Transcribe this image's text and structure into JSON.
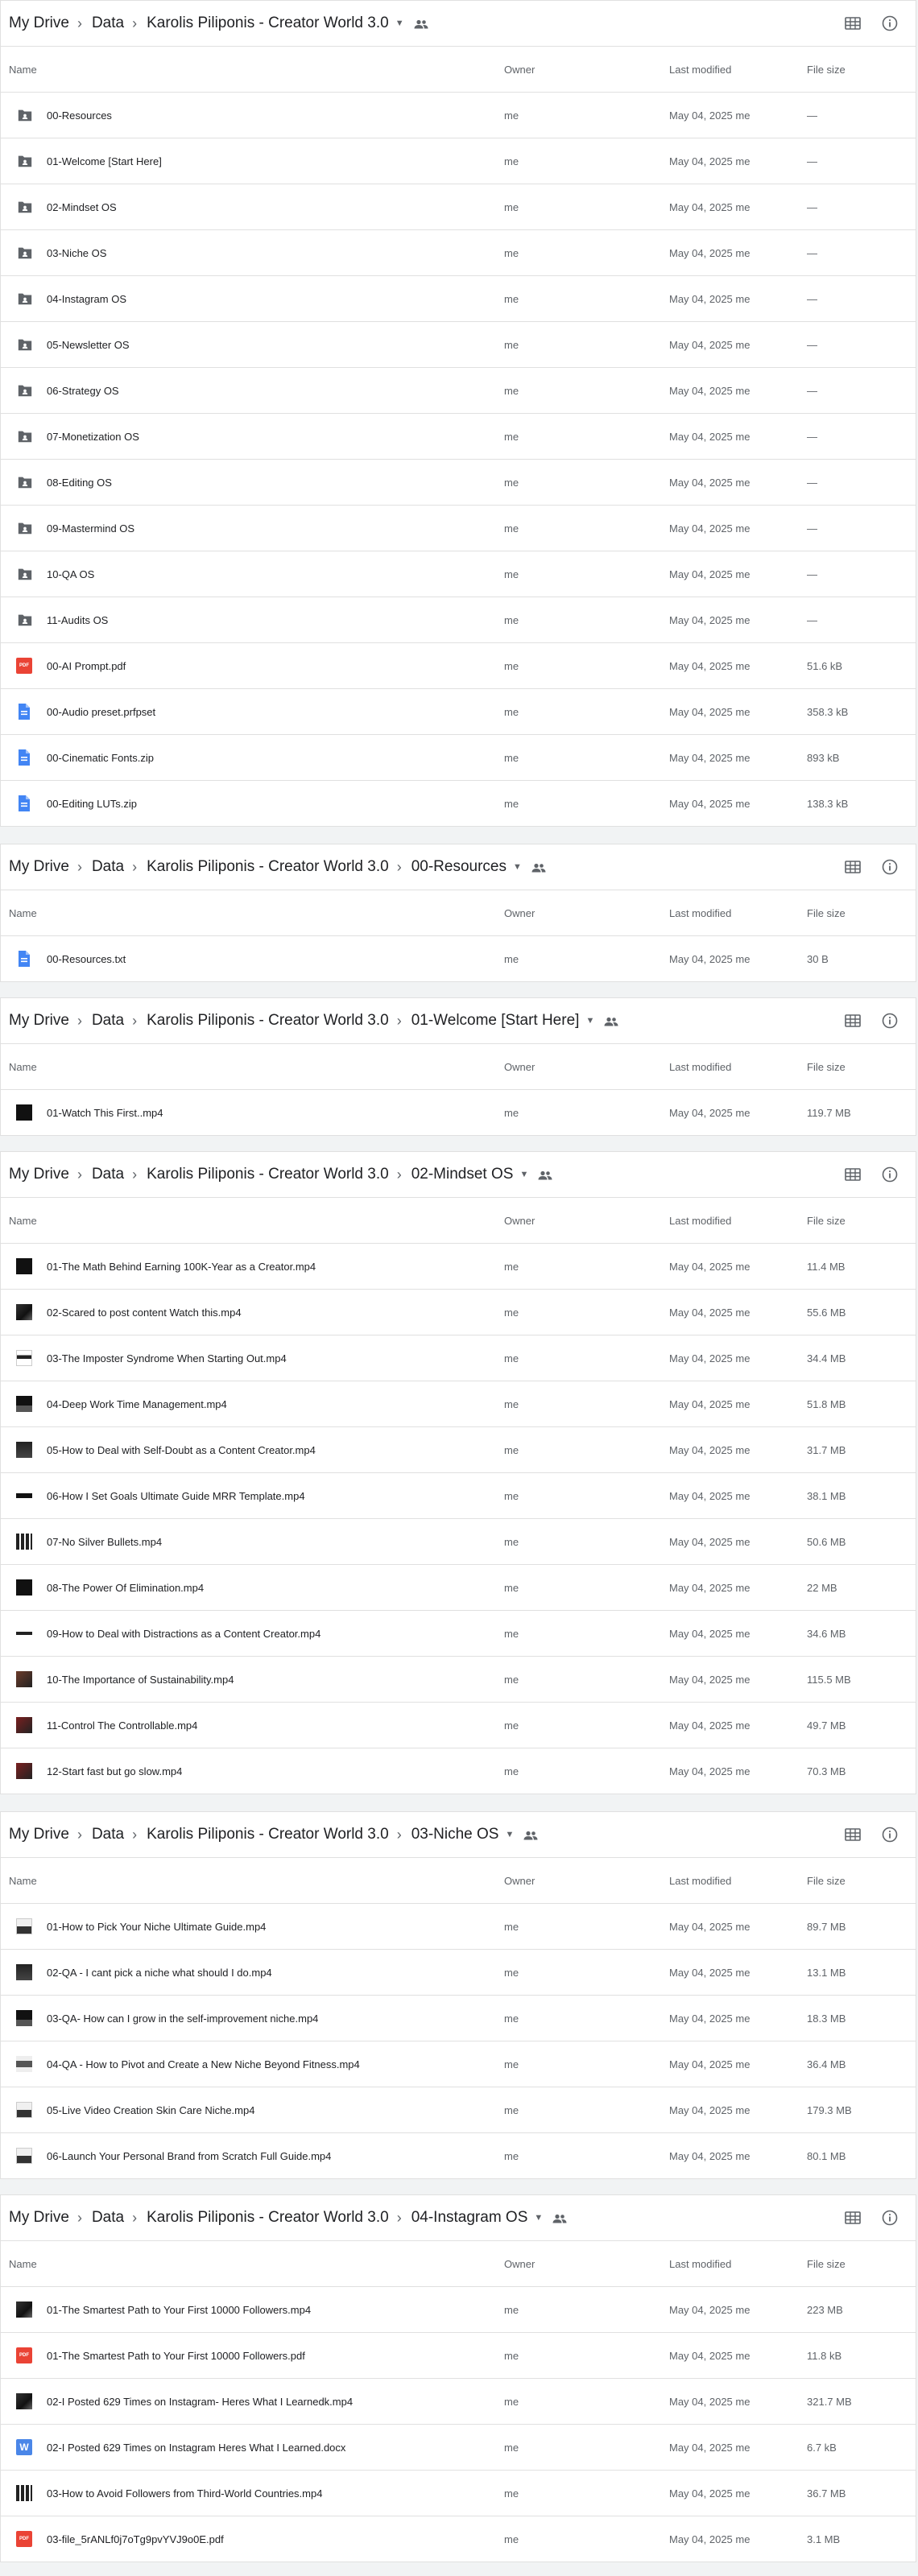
{
  "columns": {
    "name": "Name",
    "owner": "Owner",
    "modified": "Last modified",
    "size": "File size"
  },
  "sections": [
    {
      "crumbs": [
        "My Drive",
        "Data",
        "Karolis Piliponis - Creator World 3.0"
      ],
      "rows": [
        {
          "icon": "folder",
          "name": "00-Resources",
          "owner": "me",
          "modified": "May 04, 2025 me",
          "size": "—"
        },
        {
          "icon": "folder",
          "name": "01-Welcome [Start Here]",
          "owner": "me",
          "modified": "May 04, 2025 me",
          "size": "—"
        },
        {
          "icon": "folder",
          "name": "02-Mindset OS",
          "owner": "me",
          "modified": "May 04, 2025 me",
          "size": "—"
        },
        {
          "icon": "folder",
          "name": "03-Niche OS",
          "owner": "me",
          "modified": "May 04, 2025 me",
          "size": "—"
        },
        {
          "icon": "folder",
          "name": "04-Instagram OS",
          "owner": "me",
          "modified": "May 04, 2025 me",
          "size": "—"
        },
        {
          "icon": "folder",
          "name": "05-Newsletter OS",
          "owner": "me",
          "modified": "May 04, 2025 me",
          "size": "—"
        },
        {
          "icon": "folder",
          "name": "06-Strategy OS",
          "owner": "me",
          "modified": "May 04, 2025 me",
          "size": "—"
        },
        {
          "icon": "folder",
          "name": "07-Monetization OS",
          "owner": "me",
          "modified": "May 04, 2025 me",
          "size": "—"
        },
        {
          "icon": "folder",
          "name": "08-Editing OS",
          "owner": "me",
          "modified": "May 04, 2025 me",
          "size": "—"
        },
        {
          "icon": "folder",
          "name": "09-Mastermind OS",
          "owner": "me",
          "modified": "May 04, 2025 me",
          "size": "—"
        },
        {
          "icon": "folder",
          "name": "10-QA OS",
          "owner": "me",
          "modified": "May 04, 2025 me",
          "size": "—"
        },
        {
          "icon": "folder",
          "name": "11-Audits OS",
          "owner": "me",
          "modified": "May 04, 2025 me",
          "size": "—"
        },
        {
          "icon": "pdf",
          "name": "00-AI Prompt.pdf",
          "owner": "me",
          "modified": "May 04, 2025 me",
          "size": "51.6 kB"
        },
        {
          "icon": "doc",
          "name": "00-Audio preset.prfpset",
          "owner": "me",
          "modified": "May 04, 2025 me",
          "size": "358.3 kB"
        },
        {
          "icon": "doc",
          "name": "00-Cinematic Fonts.zip",
          "owner": "me",
          "modified": "May 04, 2025 me",
          "size": "893 kB"
        },
        {
          "icon": "doc",
          "name": "00-Editing LUTs.zip",
          "owner": "me",
          "modified": "May 04, 2025 me",
          "size": "138.3 kB"
        }
      ]
    },
    {
      "crumbs": [
        "My Drive",
        "Data",
        "Karolis Piliponis - Creator World 3.0",
        "00-Resources"
      ],
      "rows": [
        {
          "icon": "doc",
          "name": "00-Resources.txt",
          "owner": "me",
          "modified": "May 04, 2025 me",
          "size": "30 B"
        }
      ]
    },
    {
      "crumbs": [
        "My Drive",
        "Data",
        "Karolis Piliponis - Creator World 3.0",
        "01-Welcome [Start Here]"
      ],
      "rows": [
        {
          "icon": "v",
          "name": "01-Watch This First..mp4",
          "owner": "me",
          "modified": "May 04, 2025 me",
          "size": "119.7 MB"
        }
      ]
    },
    {
      "crumbs": [
        "My Drive",
        "Data",
        "Karolis Piliponis - Creator World 3.0",
        "02-Mindset OS"
      ],
      "rows": [
        {
          "icon": "v",
          "name": "01-The Math Behind Earning 100K-Year as a Creator.mp4",
          "owner": "me",
          "modified": "May 04, 2025 me",
          "size": "11.4 MB"
        },
        {
          "icon": "v2",
          "name": "02-Scared to post content Watch this.mp4",
          "owner": "me",
          "modified": "May 04, 2025 me",
          "size": "55.6 MB"
        },
        {
          "icon": "v3",
          "name": "03-The Imposter Syndrome When Starting Out.mp4",
          "owner": "me",
          "modified": "May 04, 2025 me",
          "size": "34.4 MB"
        },
        {
          "icon": "v1",
          "name": "04-Deep Work Time Management.mp4",
          "owner": "me",
          "modified": "May 04, 2025 me",
          "size": "51.8 MB"
        },
        {
          "icon": "v4",
          "name": "05-How to Deal with Self-Doubt as a Content Creator.mp4",
          "owner": "me",
          "modified": "May 04, 2025 me",
          "size": "31.7 MB"
        },
        {
          "icon": "v5",
          "name": "06-How I Set Goals Ultimate Guide MRR Template.mp4",
          "owner": "me",
          "modified": "May 04, 2025 me",
          "size": "38.1 MB"
        },
        {
          "icon": "v6",
          "name": "07-No Silver Bullets.mp4",
          "owner": "me",
          "modified": "May 04, 2025 me",
          "size": "50.6 MB"
        },
        {
          "icon": "v",
          "name": "08-The Power Of Elimination.mp4",
          "owner": "me",
          "modified": "May 04, 2025 me",
          "size": "22 MB"
        },
        {
          "icon": "v7",
          "name": "09-How to Deal with Distractions as a Content Creator.mp4",
          "owner": "me",
          "modified": "May 04, 2025 me",
          "size": "34.6 MB"
        },
        {
          "icon": "v8",
          "name": "10-The Importance of Sustainability.mp4",
          "owner": "me",
          "modified": "May 04, 2025 me",
          "size": "115.5 MB"
        },
        {
          "icon": "v9",
          "name": "11-Control The Controllable.mp4",
          "owner": "me",
          "modified": "May 04, 2025 me",
          "size": "49.7 MB"
        },
        {
          "icon": "v9",
          "name": "12-Start fast but go slow.mp4",
          "owner": "me",
          "modified": "May 04, 2025 me",
          "size": "70.3 MB"
        }
      ]
    },
    {
      "crumbs": [
        "My Drive",
        "Data",
        "Karolis Piliponis - Creator World 3.0",
        "03-Niche OS"
      ],
      "rows": [
        {
          "icon": "v10",
          "name": "01-How to Pick Your Niche Ultimate Guide.mp4",
          "owner": "me",
          "modified": "May 04, 2025 me",
          "size": "89.7 MB"
        },
        {
          "icon": "v4",
          "name": "02-QA - I cant pick a niche what should I do.mp4",
          "owner": "me",
          "modified": "May 04, 2025 me",
          "size": "13.1 MB"
        },
        {
          "icon": "v1",
          "name": "03-QA- How can I grow in the self-improvement niche.mp4",
          "owner": "me",
          "modified": "May 04, 2025 me",
          "size": "18.3 MB"
        },
        {
          "icon": "v11",
          "name": "04-QA - How to Pivot and Create a New Niche Beyond Fitness.mp4",
          "owner": "me",
          "modified": "May 04, 2025 me",
          "size": "36.4 MB"
        },
        {
          "icon": "v10",
          "name": "05-Live Video Creation Skin Care Niche.mp4",
          "owner": "me",
          "modified": "May 04, 2025 me",
          "size": "179.3 MB"
        },
        {
          "icon": "v10",
          "name": "06-Launch Your Personal Brand from Scratch Full Guide.mp4",
          "owner": "me",
          "modified": "May 04, 2025 me",
          "size": "80.1 MB"
        }
      ]
    },
    {
      "crumbs": [
        "My Drive",
        "Data",
        "Karolis Piliponis - Creator World 3.0",
        "04-Instagram OS"
      ],
      "rows": [
        {
          "icon": "v2",
          "name": "01-The Smartest Path to Your First 10000 Followers.mp4",
          "owner": "me",
          "modified": "May 04, 2025 me",
          "size": "223 MB"
        },
        {
          "icon": "pdf",
          "name": "01-The Smartest Path to Your First 10000 Followers.pdf",
          "owner": "me",
          "modified": "May 04, 2025 me",
          "size": "11.8 kB"
        },
        {
          "icon": "v2",
          "name": "02-I Posted 629 Times on Instagram- Heres What I Learnedk.mp4",
          "owner": "me",
          "modified": "May 04, 2025 me",
          "size": "321.7 MB"
        },
        {
          "icon": "word",
          "name": "02-I Posted 629 Times on Instagram Heres What I Learned.docx",
          "owner": "me",
          "modified": "May 04, 2025 me",
          "size": "6.7 kB"
        },
        {
          "icon": "v6",
          "name": "03-How to Avoid Followers from Third-World Countries.mp4",
          "owner": "me",
          "modified": "May 04, 2025 me",
          "size": "36.7 MB"
        },
        {
          "icon": "pdf",
          "name": "03-file_5rANLf0j7oTg9pvYVJ9o0E.pdf",
          "owner": "me",
          "modified": "May 04, 2025 me",
          "size": "3.1 MB"
        }
      ]
    }
  ],
  "pdf_label": "PDF",
  "word_label": "W"
}
